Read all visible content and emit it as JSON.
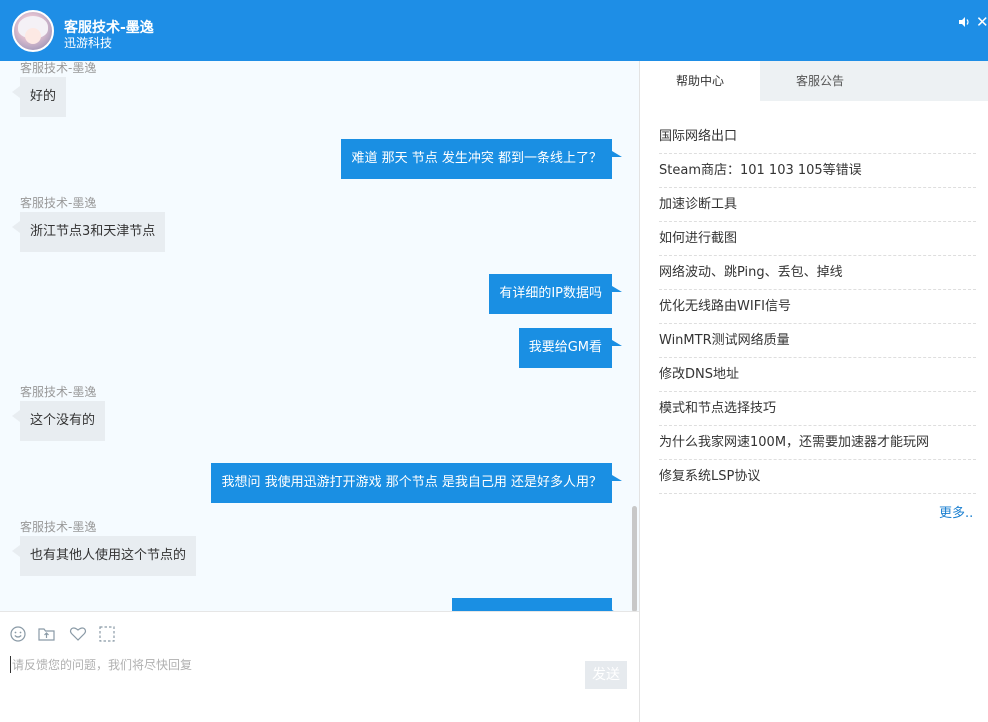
{
  "header": {
    "title": "客服技术-墨逸",
    "subtitle": "迅游科技",
    "sound_icon": "speaker-icon",
    "close_icon": "close-icon",
    "close_glyph": "✕",
    "sound_glyph": "◀"
  },
  "chat": {
    "messages": [
      {
        "from": "agent",
        "name": "客服技术-墨逸",
        "text": "好的"
      },
      {
        "from": "user",
        "text": "难道 那天 节点 发生冲突 都到一条线上了？"
      },
      {
        "from": "agent",
        "name": "客服技术-墨逸",
        "text": "浙江节点3和天津节点"
      },
      {
        "from": "user",
        "text": "有详细的IP数据吗"
      },
      {
        "from": "user",
        "text": "我要给GM看"
      },
      {
        "from": "agent",
        "name": "客服技术-墨逸",
        "text": "这个没有的"
      },
      {
        "from": "user",
        "text": "我想问 我使用迅游打开游戏 那个节点 是我自己用 还是好多人用？"
      },
      {
        "from": "agent",
        "name": "客服技术-墨逸",
        "text": "也有其他人使用这个节点的"
      },
      {
        "from": "user",
        "text": ""
      }
    ]
  },
  "input": {
    "placeholder": "请反馈您的问题，我们将尽快回复",
    "send_label": "发送",
    "tools": [
      "emoji-icon",
      "upload-icon",
      "heart-icon",
      "screenshot-icon"
    ]
  },
  "right_panel": {
    "tabs": [
      {
        "label": "帮助中心",
        "active": true
      },
      {
        "label": "客服公告",
        "active": false
      }
    ],
    "help_items": [
      "国际网络出口",
      "Steam商店：101 103 105等错误",
      "加速诊断工具",
      "如何进行截图",
      "网络波动、跳Ping、丢包、掉线",
      "优化无线路由WIFI信号",
      "WinMTR测试网络质量",
      "修改DNS地址",
      "模式和节点选择技巧",
      "为什么我家网速100M，还需要加速器才能玩网",
      "修复系统LSP协议"
    ],
    "more_label": "更多.."
  },
  "colors": {
    "header_bg": "#1e8ee6",
    "user_bubble": "#1a8fe3",
    "agent_bubble": "#e8edf1",
    "chat_bg": "#f5fbff",
    "link": "#1a7fd0"
  }
}
